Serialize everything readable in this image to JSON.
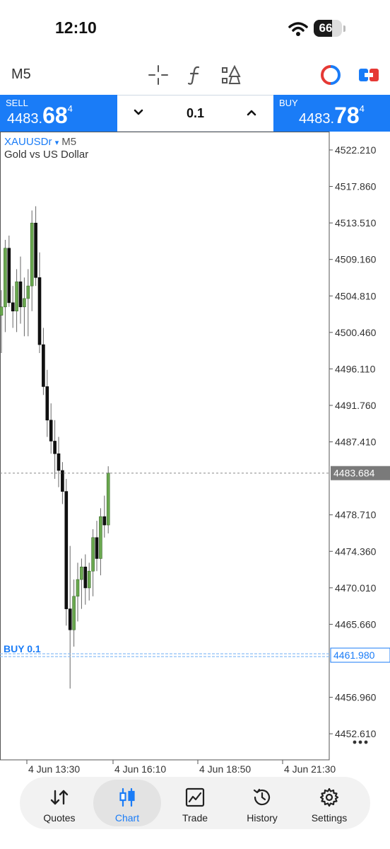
{
  "status_bar": {
    "time": "12:10",
    "battery_percent": "66",
    "battery_level": 0.66
  },
  "toolbar": {
    "timeframe": "M5",
    "icons": [
      "crosshair-icon",
      "indicators-icon",
      "objects-icon",
      "chart-type-icon",
      "trade-panel-icon"
    ]
  },
  "trade_bar": {
    "sell": {
      "label": "SELL",
      "price_prefix": "4483.",
      "price_big": "68",
      "price_super": "4"
    },
    "buy": {
      "label": "BUY",
      "price_prefix": "4483.",
      "price_big": "78",
      "price_super": "4"
    },
    "lot": "0.1"
  },
  "chart": {
    "symbol": "XAUUSDr",
    "symbol_arrow": "▾",
    "timeframe": "M5",
    "description": "Gold vs US Dollar",
    "price_axis": [
      "4522.210",
      "4517.860",
      "4513.510",
      "4509.160",
      "4504.810",
      "4500.460",
      "4496.110",
      "4491.760",
      "4487.410",
      "4478.710",
      "4474.360",
      "4470.010",
      "4465.660",
      "4456.960",
      "4452.610"
    ],
    "time_axis": [
      "4 Jun 13:30",
      "4 Jun 16:10",
      "4 Jun 18:50",
      "4 Jun 21:30"
    ],
    "bid_line": {
      "price": 4483.684,
      "label": "4483.684"
    },
    "order_line": {
      "price": 4461.98,
      "label": "4461.980",
      "text": "BUY 0.1"
    },
    "colors": {
      "bull": "#6aa84f",
      "bear": "#111111",
      "accent": "#1a7cf7",
      "order": "#7fb6f5"
    }
  },
  "chart_data": {
    "type": "candlestick",
    "title": "XAUUSDr, M5",
    "ylim": [
      4449.5,
      4524.4
    ],
    "candles": [
      {
        "o": 4502.5,
        "h": 4505.5,
        "l": 4498.0,
        "c": 4503.5
      },
      {
        "o": 4503.5,
        "h": 4511.5,
        "l": 4500.5,
        "c": 4510.5
      },
      {
        "o": 4510.5,
        "h": 4512.0,
        "l": 4503.5,
        "c": 4504.0
      },
      {
        "o": 4504.0,
        "h": 4506.0,
        "l": 4501.0,
        "c": 4503.0
      },
      {
        "o": 4503.0,
        "h": 4508.0,
        "l": 4500.5,
        "c": 4506.5
      },
      {
        "o": 4506.5,
        "h": 4509.5,
        "l": 4501.5,
        "c": 4503.5
      },
      {
        "o": 4503.5,
        "h": 4507.0,
        "l": 4500.0,
        "c": 4504.5
      },
      {
        "o": 4504.5,
        "h": 4508.0,
        "l": 4500.0,
        "c": 4506.0
      },
      {
        "o": 4506.0,
        "h": 4515.0,
        "l": 4503.0,
        "c": 4513.5
      },
      {
        "o": 4513.5,
        "h": 4515.5,
        "l": 4506.0,
        "c": 4507.0
      },
      {
        "o": 4507.0,
        "h": 4510.0,
        "l": 4498.0,
        "c": 4499.0
      },
      {
        "o": 4499.0,
        "h": 4501.0,
        "l": 4493.0,
        "c": 4494.0
      },
      {
        "o": 4494.0,
        "h": 4496.0,
        "l": 4488.0,
        "c": 4490.0
      },
      {
        "o": 4490.0,
        "h": 4492.0,
        "l": 4486.0,
        "c": 4487.5
      },
      {
        "o": 4487.5,
        "h": 4490.0,
        "l": 4483.0,
        "c": 4486.0
      },
      {
        "o": 4486.0,
        "h": 4488.0,
        "l": 4482.0,
        "c": 4484.0
      },
      {
        "o": 4484.0,
        "h": 4485.0,
        "l": 4480.0,
        "c": 4481.5
      },
      {
        "o": 4481.5,
        "h": 4483.0,
        "l": 4465.5,
        "c": 4467.5
      },
      {
        "o": 4467.5,
        "h": 4475.0,
        "l": 4458.0,
        "c": 4465.0
      },
      {
        "o": 4465.0,
        "h": 4471.0,
        "l": 4463.0,
        "c": 4469.0
      },
      {
        "o": 4469.0,
        "h": 4473.0,
        "l": 4466.0,
        "c": 4471.0
      },
      {
        "o": 4471.0,
        "h": 4473.5,
        "l": 4467.5,
        "c": 4472.5
      },
      {
        "o": 4472.5,
        "h": 4474.0,
        "l": 4468.0,
        "c": 4470.0
      },
      {
        "o": 4470.0,
        "h": 4473.0,
        "l": 4468.5,
        "c": 4472.0
      },
      {
        "o": 4472.0,
        "h": 4477.0,
        "l": 4469.0,
        "c": 4476.0
      },
      {
        "o": 4476.0,
        "h": 4478.0,
        "l": 4472.0,
        "c": 4473.5
      },
      {
        "o": 4473.5,
        "h": 4479.5,
        "l": 4471.5,
        "c": 4478.5
      },
      {
        "o": 4478.5,
        "h": 4481.0,
        "l": 4476.0,
        "c": 4477.5
      },
      {
        "o": 4477.5,
        "h": 4484.5,
        "l": 4476.5,
        "c": 4483.7
      }
    ]
  },
  "nav": {
    "items": [
      {
        "label": "Quotes",
        "icon": "quotes-arrows-icon",
        "active": false
      },
      {
        "label": "Chart",
        "icon": "chart-candles-icon",
        "active": true
      },
      {
        "label": "Trade",
        "icon": "trade-chart-icon",
        "active": false
      },
      {
        "label": "History",
        "icon": "history-clock-icon",
        "active": false
      },
      {
        "label": "Settings",
        "icon": "settings-gear-icon",
        "active": false
      }
    ]
  }
}
